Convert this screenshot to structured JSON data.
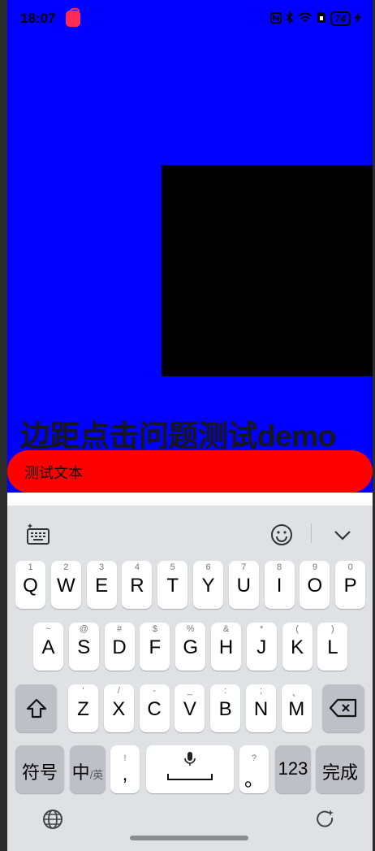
{
  "status_bar": {
    "time": "18:07",
    "battery": "74"
  },
  "content": {
    "title": "边距点击问题测试demo",
    "input_text": "测试文本"
  },
  "keyboard": {
    "row1": [
      {
        "hint": "1",
        "char": "Q"
      },
      {
        "hint": "2",
        "char": "W"
      },
      {
        "hint": "3",
        "char": "E"
      },
      {
        "hint": "4",
        "char": "R"
      },
      {
        "hint": "5",
        "char": "T"
      },
      {
        "hint": "6",
        "char": "Y"
      },
      {
        "hint": "7",
        "char": "U"
      },
      {
        "hint": "8",
        "char": "I"
      },
      {
        "hint": "9",
        "char": "O"
      },
      {
        "hint": "0",
        "char": "P"
      }
    ],
    "row2": [
      {
        "hint": "~",
        "char": "A"
      },
      {
        "hint": "@",
        "char": "S"
      },
      {
        "hint": "#",
        "char": "D"
      },
      {
        "hint": "$",
        "char": "F"
      },
      {
        "hint": "%",
        "char": "G"
      },
      {
        "hint": "&",
        "char": "H"
      },
      {
        "hint": "*",
        "char": "J"
      },
      {
        "hint": "(",
        "char": "K"
      },
      {
        "hint": ")",
        "char": "L"
      }
    ],
    "row3": [
      {
        "hint": "'",
        "char": "Z"
      },
      {
        "hint": "/",
        "char": "X"
      },
      {
        "hint": "-",
        "char": "C"
      },
      {
        "hint": "_",
        "char": "V"
      },
      {
        "hint": ":",
        "char": "B"
      },
      {
        "hint": ";",
        "char": "N"
      },
      {
        "hint": "、",
        "char": "M"
      }
    ],
    "symbols_label": "符号",
    "lang_label_main": "中",
    "lang_label_sub": "/英",
    "comma_hint": "!",
    "comma_char": ",",
    "period_hint": "?",
    "period_char": "。",
    "num_label": "123",
    "done_label": "完成"
  }
}
